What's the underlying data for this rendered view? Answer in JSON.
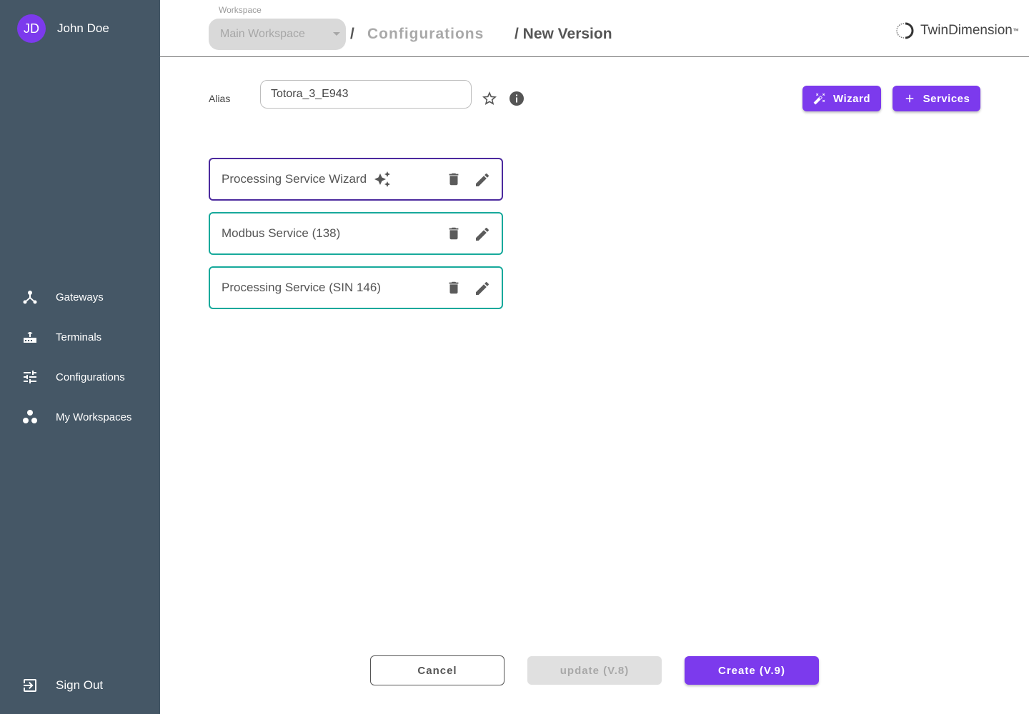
{
  "user": {
    "initials": "JD",
    "name": "John Doe"
  },
  "sidebar": {
    "items": [
      {
        "label": "Gateways",
        "icon": "gateway-icon"
      },
      {
        "label": "Terminals",
        "icon": "router-icon"
      },
      {
        "label": "Configurations",
        "icon": "tune-icon"
      },
      {
        "label": "My Workspaces",
        "icon": "workspaces-icon"
      }
    ],
    "signout_label": "Sign Out"
  },
  "header": {
    "workspace_label": "Workspace",
    "workspace_value": "Main Workspace",
    "breadcrumb": {
      "sep": "/",
      "parent": "Configurations",
      "current": "/ New Version"
    },
    "logo_text": "TwinDimension",
    "logo_mark": "™"
  },
  "alias": {
    "label": "Alias",
    "value": "Totora_3_E943"
  },
  "toolbar": {
    "wizard_label": "Wizard",
    "services_label": "Services"
  },
  "services": [
    {
      "label": "Processing Service Wizard",
      "type": "wizard"
    },
    {
      "label": "Modbus Service (138)",
      "type": "service"
    },
    {
      "label": "Processing Service (SIN 146)",
      "type": "service"
    }
  ],
  "footer": {
    "cancel_label": "Cancel",
    "update_label": "update (V.8)",
    "create_label": "Create (V.9)"
  },
  "colors": {
    "accent": "#7c3aed",
    "sidebar": "#455766",
    "card_border": "#17a99b",
    "wizard_border": "#4c2a9e"
  }
}
